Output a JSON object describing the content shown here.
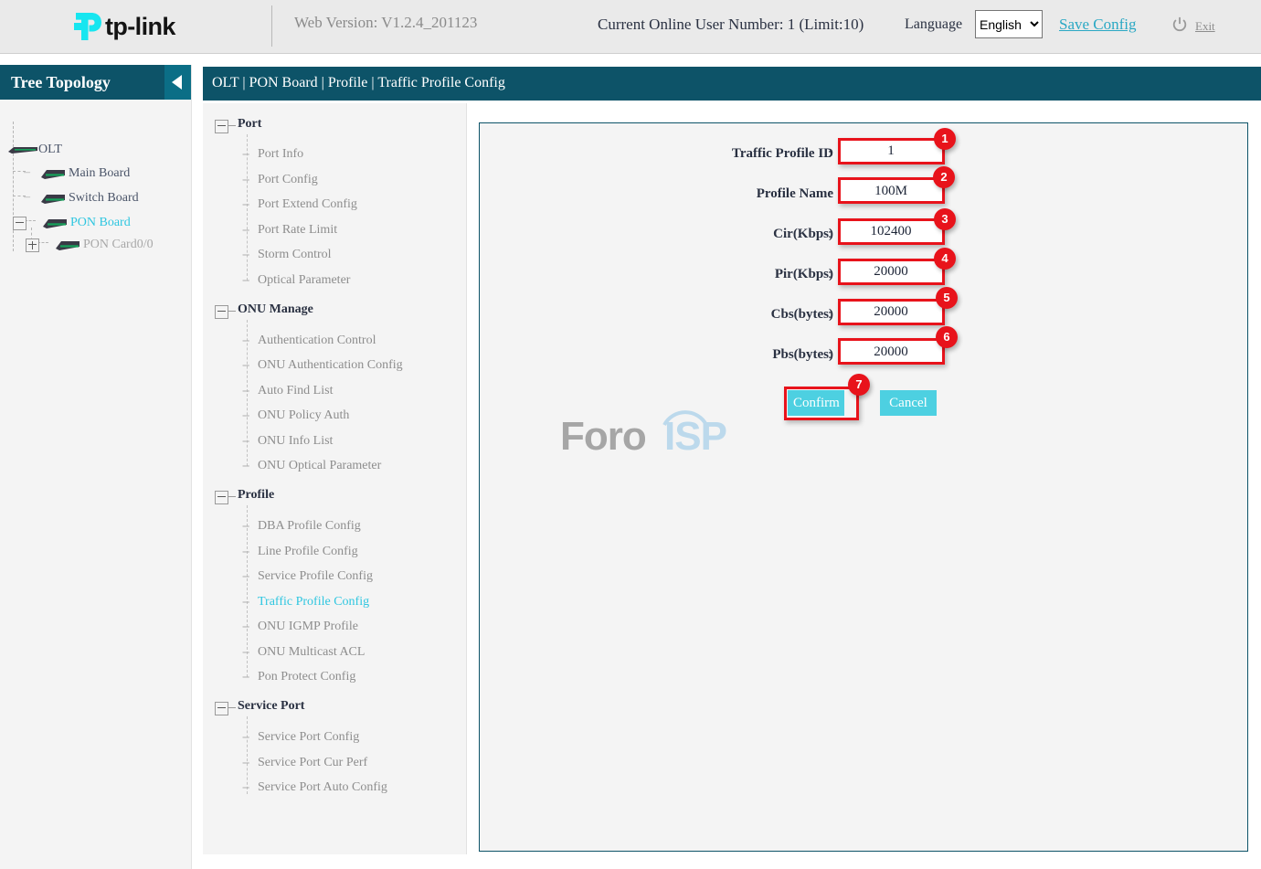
{
  "header": {
    "logo_text": "tp-link",
    "logo_icon": "tplink-logo-icon",
    "web_version": "Web Version: V1.2.4_201123",
    "online_users": "Current Online User Number: 1 (Limit:10)",
    "language_label": "Language",
    "language_selected": "English",
    "language_options": [
      "English"
    ],
    "save_config": "Save Config",
    "exit": "Exit",
    "power_icon": "power-icon",
    "accent_color": "#2aa8c4"
  },
  "tree": {
    "title": "Tree Topology",
    "collapse_icon": "chevron-left-icon",
    "header_bg": "#0d5368",
    "nodes": [
      {
        "label": "OLT",
        "state": "normal",
        "icon": "olt-device-icon"
      },
      {
        "label": "Main Board",
        "state": "normal",
        "icon": "board-icon"
      },
      {
        "label": "Switch Board",
        "state": "normal",
        "icon": "board-icon"
      },
      {
        "label": "PON Board",
        "state": "active",
        "icon": "board-icon"
      },
      {
        "label": "PON Card0/0",
        "state": "muted",
        "icon": "board-icon"
      }
    ]
  },
  "nav": {
    "groups": [
      {
        "label": "Port",
        "items": [
          "Port Info",
          "Port Config",
          "Port Extend Config",
          "Port Rate Limit",
          "Storm Control",
          "Optical Parameter"
        ]
      },
      {
        "label": "ONU Manage",
        "items": [
          "Authentication Control",
          "ONU Authentication Config",
          "Auto Find List",
          "ONU Policy Auth",
          "ONU Info List",
          "ONU Optical Parameter"
        ]
      },
      {
        "label": "Profile",
        "items": [
          "DBA Profile Config",
          "Line Profile Config",
          "Service Profile Config",
          "Traffic Profile Config",
          "ONU IGMP Profile",
          "ONU Multicast ACL",
          "Pon Protect Config"
        ]
      },
      {
        "label": "Service Port",
        "items": [
          "Service Port Config",
          "Service Port Cur Perf",
          "Service Port Auto Config"
        ]
      }
    ],
    "active_item": "Traffic Profile Config",
    "active_color": "#2ec6e0"
  },
  "content": {
    "breadcrumb": "OLT | PON Board | Profile | Traffic Profile Config",
    "watermark": {
      "part1": "Foro",
      "part2": "ISP",
      "icon": "wifi-signal-icon"
    },
    "form": {
      "fields": [
        {
          "label": "Traffic Profile ID",
          "value": "1",
          "badge": "1"
        },
        {
          "label": "Profile Name",
          "value": "100M",
          "badge": "2"
        },
        {
          "label": "Cir(Kbps)",
          "value": "102400",
          "badge": "3"
        },
        {
          "label": "Pir(Kbps)",
          "value": "20000",
          "badge": "4"
        },
        {
          "label": "Cbs(bytes)",
          "value": "20000",
          "badge": "5"
        },
        {
          "label": "Pbs(bytes)",
          "value": "20000",
          "badge": "6"
        }
      ],
      "confirm_label": "Confirm",
      "cancel_label": "Cancel",
      "confirm_badge": "7",
      "button_color": "#4dd0e1",
      "highlight_color": "#e8131b"
    }
  }
}
